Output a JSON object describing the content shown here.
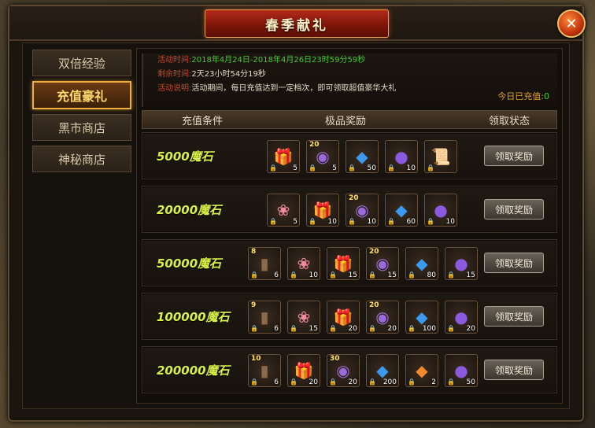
{
  "window": {
    "title": "春季献礼",
    "close_icon": "close-icon"
  },
  "sidebar": {
    "tabs": [
      {
        "label": "双倍经验",
        "active": false
      },
      {
        "label": "充值豪礼",
        "active": true
      },
      {
        "label": "黑市商店",
        "active": false
      },
      {
        "label": "神秘商店",
        "active": false
      }
    ]
  },
  "info": {
    "time_label": "活动时间:",
    "time_value": "2018年4月24日-2018年4月26日23时59分59秒",
    "remain_label": "剩余时间:",
    "remain_value": "2天23小时54分19秒",
    "desc_label": "活动说明:",
    "desc_value": "活动期间，每日充值达到一定档次，即可领取超值豪华大礼",
    "today_label": "今日已充值:",
    "today_value": "0"
  },
  "table": {
    "headers": [
      "充值条件",
      "极品奖励",
      "领取状态"
    ],
    "claim_label": "领取奖励",
    "rows": [
      {
        "condition": "5000魔石",
        "items": [
          {
            "icon": "gift-box-icon",
            "count": "5"
          },
          {
            "icon": "soul-orb-icon",
            "count": "5",
            "level": "20"
          },
          {
            "icon": "blue-gem-icon",
            "count": "50"
          },
          {
            "icon": "exp-orb-icon",
            "count": "10"
          },
          {
            "icon": "scroll-icon",
            "count": ""
          }
        ]
      },
      {
        "condition": "20000魔石",
        "items": [
          {
            "icon": "lotus-icon",
            "count": "5"
          },
          {
            "icon": "gift-box-icon",
            "count": "10"
          },
          {
            "icon": "soul-orb-icon",
            "count": "10",
            "level": "20"
          },
          {
            "icon": "blue-gem-icon",
            "count": "60"
          },
          {
            "icon": "exp-orb-icon",
            "count": "10"
          }
        ]
      },
      {
        "condition": "50000魔石",
        "items": [
          {
            "icon": "card-icon",
            "count": "6",
            "level": "8"
          },
          {
            "icon": "lotus-icon",
            "count": "10"
          },
          {
            "icon": "gift-box-icon",
            "count": "15"
          },
          {
            "icon": "soul-orb-icon",
            "count": "15",
            "level": "20"
          },
          {
            "icon": "blue-gem-icon",
            "count": "80"
          },
          {
            "icon": "exp-orb-icon",
            "count": "15"
          }
        ]
      },
      {
        "condition": "100000魔石",
        "items": [
          {
            "icon": "card-icon",
            "count": "6",
            "level": "9"
          },
          {
            "icon": "lotus-icon",
            "count": "15"
          },
          {
            "icon": "gift-box-icon",
            "count": "20"
          },
          {
            "icon": "soul-orb-icon",
            "count": "20",
            "level": "20"
          },
          {
            "icon": "blue-gem-icon",
            "count": "100"
          },
          {
            "icon": "exp-orb-icon",
            "count": "20"
          }
        ]
      },
      {
        "condition": "200000魔石",
        "items": [
          {
            "icon": "card-icon",
            "count": "6",
            "level": "10"
          },
          {
            "icon": "gold-gift-box-icon",
            "count": "20"
          },
          {
            "icon": "soul-orb-icon",
            "count": "20",
            "level": "30"
          },
          {
            "icon": "blue-gem-icon",
            "count": "200"
          },
          {
            "icon": "fire-gem-icon",
            "count": "2"
          },
          {
            "icon": "exp-orb-icon",
            "count": "50"
          }
        ]
      }
    ]
  }
}
